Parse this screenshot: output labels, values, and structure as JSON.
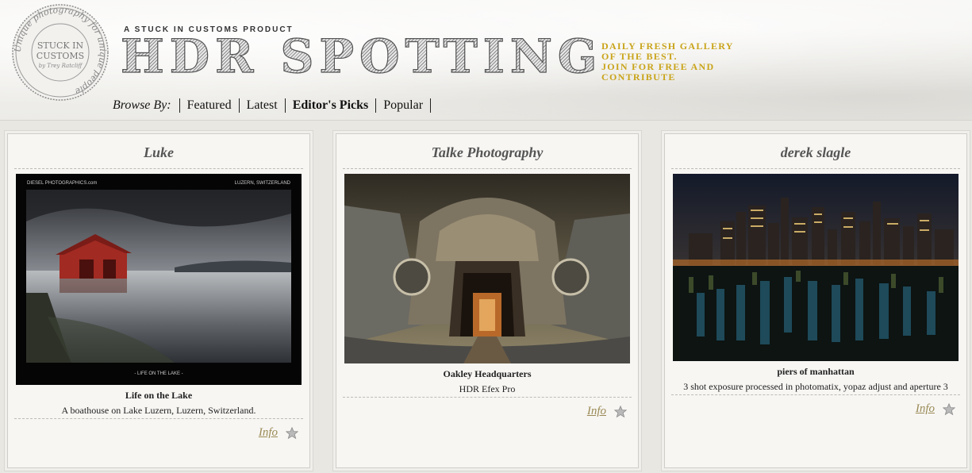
{
  "header": {
    "seal_text_ring": "Unique photography for unique people",
    "seal_text_center": [
      "STUCK IN",
      "CUSTOMS"
    ],
    "seal_text_author": "by Trey Ratcliff",
    "tagline": "A STUCK IN CUSTOMS PRODUCT",
    "logo": "HDR SPOTTING",
    "promo": [
      "DAILY FRESH GALLERY",
      "OF THE BEST.",
      "JOIN FOR FREE AND",
      "CONTRIBUTE"
    ],
    "accent_color": "#c9a41a"
  },
  "browse": {
    "label": "Browse By:",
    "items": [
      {
        "label": "Featured",
        "active": false
      },
      {
        "label": "Latest",
        "active": false
      },
      {
        "label": "Editor's Picks",
        "active": true
      },
      {
        "label": "Popular",
        "active": false
      }
    ]
  },
  "cards": [
    {
      "author": "Luke",
      "photo": {
        "title": "Life on the Lake",
        "overlay_top_left": "DIESEL PHOTOGRAPHICS.com",
        "overlay_top_right": "LUZERN, SWITZERLAND",
        "overlay_bottom": "- LIFE ON THE LAKE -"
      },
      "caption_title": "Life on the Lake",
      "caption_desc": "A boathouse on Lake Luzern, Luzern, Switzerland.",
      "info_label": "Info",
      "star_icon": "star-icon"
    },
    {
      "author": "Talke Photography",
      "photo": {
        "title": "Oakley Headquarters"
      },
      "caption_title": "Oakley Headquarters",
      "caption_desc": "HDR Efex Pro",
      "info_label": "Info",
      "star_icon": "star-icon"
    },
    {
      "author": "derek slagle",
      "photo": {
        "title": "piers of manhattan"
      },
      "caption_title": "piers of manhattan",
      "caption_desc": "3 shot exposure processed in photomatix, yopaz adjust and aperture 3",
      "info_label": "Info",
      "star_icon": "star-icon"
    }
  ]
}
